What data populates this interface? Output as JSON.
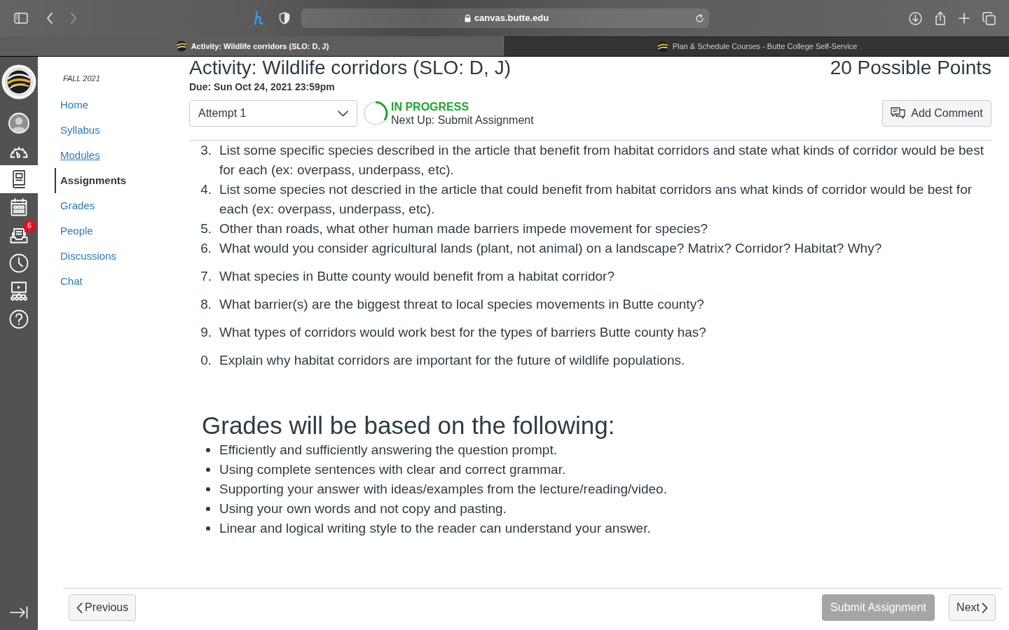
{
  "browser": {
    "back_disabled": false,
    "forward_disabled": true,
    "url": "canvas.butte.edu",
    "tabs": [
      {
        "title": "Activity: Wildlife corridors (SLO: D, J)",
        "selected": true
      },
      {
        "title": "Plan & Schedule Courses - Butte College Self-Service",
        "selected": false
      }
    ]
  },
  "global_nav": {
    "items": [
      {
        "kind": "account",
        "selected": false
      },
      {
        "kind": "dashboard",
        "selected": false
      },
      {
        "kind": "courses",
        "selected": true
      },
      {
        "kind": "calendar",
        "selected": false
      },
      {
        "kind": "inbox",
        "selected": false,
        "badge": "6"
      },
      {
        "kind": "history",
        "selected": false
      },
      {
        "kind": "studio",
        "selected": false
      },
      {
        "kind": "help",
        "selected": false
      }
    ]
  },
  "course_nav": {
    "term": "FALL 2021",
    "items": [
      {
        "label": "Home",
        "selected": false,
        "hovered": false
      },
      {
        "label": "Syllabus",
        "selected": false,
        "hovered": false
      },
      {
        "label": "Modules",
        "selected": false,
        "hovered": true
      },
      {
        "label": "Assignments",
        "selected": true,
        "hovered": false
      },
      {
        "label": "Grades",
        "selected": false,
        "hovered": false
      },
      {
        "label": "People",
        "selected": false,
        "hovered": false
      },
      {
        "label": "Discussions",
        "selected": false,
        "hovered": false
      },
      {
        "label": "Chat",
        "selected": false,
        "hovered": false
      }
    ]
  },
  "assignment": {
    "title": "Activity: Wildlife corridors (SLO: D, J)",
    "points": "20 Possible Points",
    "due": "Due: Sun Oct 24, 2021 23:59pm",
    "attempt": "Attempt 1",
    "status": {
      "label": "IN PROGRESS",
      "next_up": "Next Up: Submit Assignment",
      "level": 0.35
    },
    "add_comment": "Add Comment"
  },
  "questions": [
    {
      "number": "3.",
      "text": "List some specific species described in the article that benefit from habitat corridors and state what kinds of corridor would be best for each (ex: overpass, underpass, etc).",
      "kind": "line"
    },
    {
      "number": "4.",
      "text": "List some species not descried in the article that could benefit from habitat corridors ans what kinds of corridor would be best for each (ex: overpass, underpass, etc).",
      "kind": "line"
    },
    {
      "number": "5.",
      "text": "Other than roads, what other human made barriers impede movement for species?",
      "kind": "line"
    },
    {
      "number": "6.",
      "text": "What would you consider agricultural lands (plant, not animal) on a landscape? Matrix? Corridor? Habitat? Why?",
      "kind": "line"
    },
    {
      "number": "7.",
      "text": "What species in Butte county would benefit from a habitat corridor?",
      "kind": "paragraph"
    },
    {
      "number": "8.",
      "text": "What barrier(s) are the biggest threat to local species movements in Butte county?",
      "kind": "paragraph"
    },
    {
      "number": "9.",
      "text": "What types of corridors would work best for the types of barriers Butte county has?",
      "kind": "paragraph"
    },
    {
      "number": "0.",
      "text": "Explain why habitat corridors are important for the future of wildlife populations.",
      "kind": "paragraph"
    }
  ],
  "grading": {
    "heading": "Grades will be based on the following:",
    "criteria": [
      "Efficiently and sufficiently answering the question prompt.",
      "Using complete sentences with clear and correct grammar.",
      "Supporting your answer with ideas/examples from the lecture/reading/video.",
      "Using your own words and not copy and pasting.",
      "Linear and logical writing style to the reader can understand your answer."
    ]
  },
  "footer": {
    "previous": "Previous",
    "submit": {
      "label": "Submit Assignment",
      "disabled": true
    },
    "next": "Next"
  }
}
